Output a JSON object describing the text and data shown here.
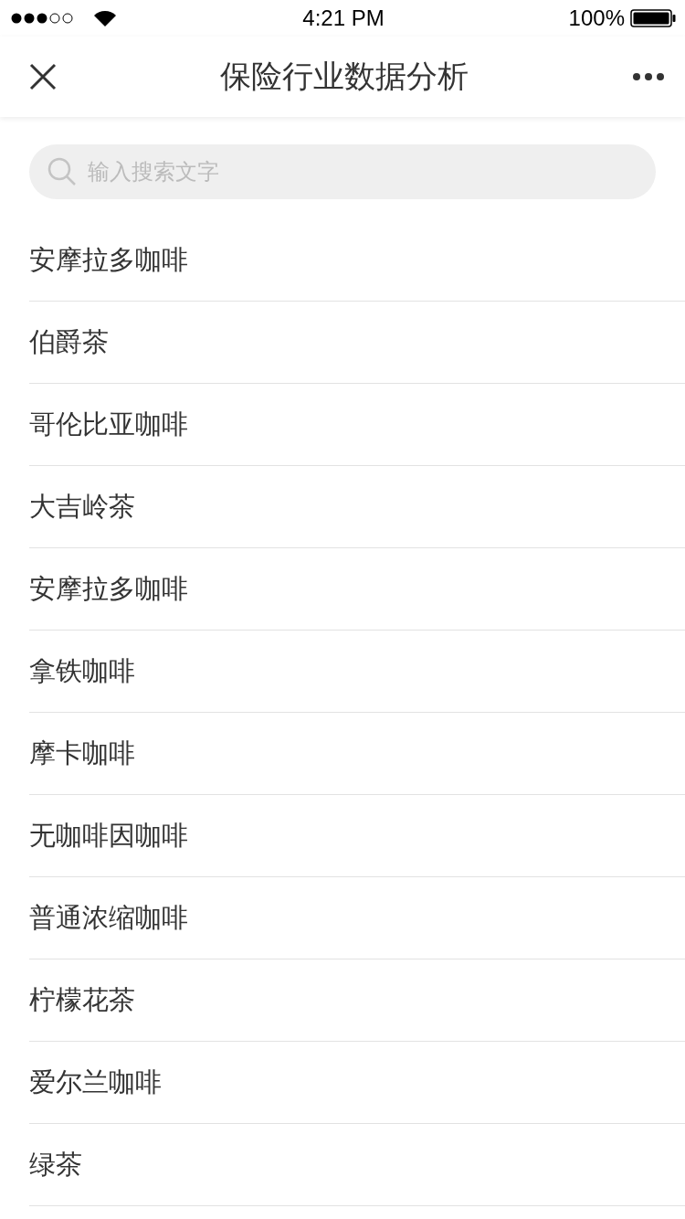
{
  "status_bar": {
    "time": "4:21 PM",
    "battery": "100%"
  },
  "nav": {
    "title": "保险行业数据分析"
  },
  "search": {
    "placeholder": "输入搜索文字"
  },
  "items": [
    {
      "label": "安摩拉多咖啡"
    },
    {
      "label": "伯爵茶"
    },
    {
      "label": "哥伦比亚咖啡"
    },
    {
      "label": "大吉岭茶"
    },
    {
      "label": "安摩拉多咖啡"
    },
    {
      "label": "拿铁咖啡"
    },
    {
      "label": "摩卡咖啡"
    },
    {
      "label": "无咖啡因咖啡"
    },
    {
      "label": "普通浓缩咖啡"
    },
    {
      "label": "柠檬花茶"
    },
    {
      "label": "爱尔兰咖啡"
    },
    {
      "label": "绿茶"
    }
  ]
}
